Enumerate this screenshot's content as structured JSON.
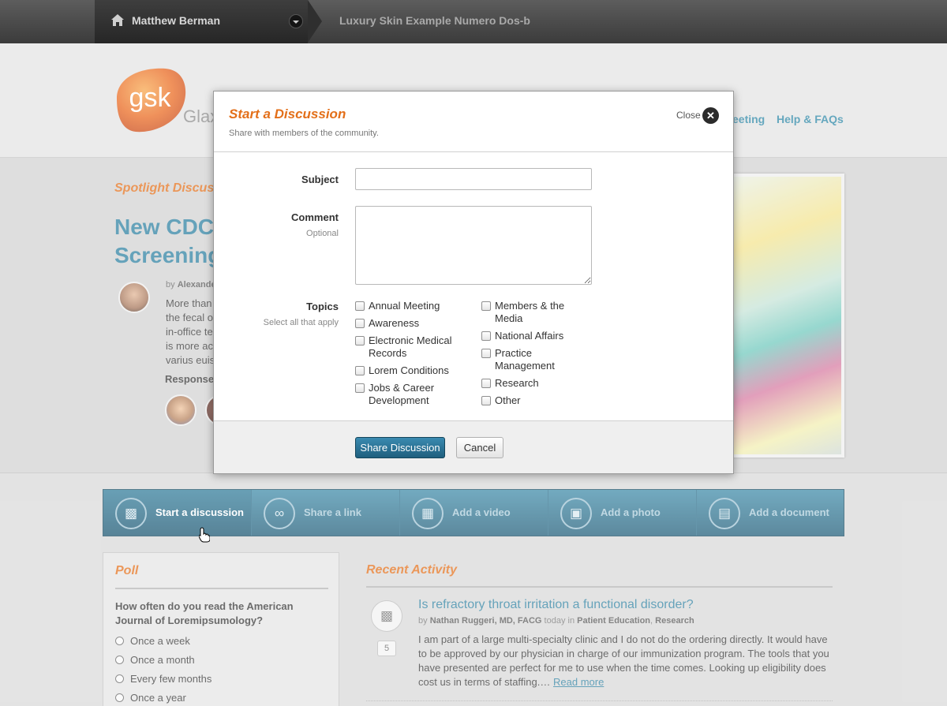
{
  "topbar": {
    "user_name": "Matthew Berman",
    "site_title": "Luxury Skin Example Numero Dos-b"
  },
  "header": {
    "logo_text": "gsk",
    "logo_wordmark": "Glax",
    "nav": {
      "meeting": "eeting",
      "help": "Help & FAQs"
    }
  },
  "spotlight": {
    "heading": "Spotlight Discuss",
    "title_line1": "New CDC",
    "title_line2": "Screening",
    "byline_prefix": "by",
    "byline_author": "Alexande",
    "excerpt": [
      "More than",
      "the fecal o",
      "in-office te",
      "is more ac",
      "varius euis"
    ],
    "responses_label": "Responses"
  },
  "modal": {
    "title": "Start a Discussion",
    "subtitle": "Share with members of the community.",
    "close_label": "Close",
    "subject_label": "Subject",
    "subject_value": "",
    "comment_label": "Comment",
    "comment_hint": "Optional",
    "comment_value": "",
    "topics_label": "Topics",
    "topics_hint": "Select all that apply",
    "topics_col1": [
      "Annual Meeting",
      "Awareness",
      "Electronic Medical Records",
      "Lorem Conditions",
      "Jobs & Career Development"
    ],
    "topics_col2": [
      "Members & the Media",
      "National Affairs",
      "Practice Management",
      "Research",
      "Other"
    ],
    "share_label": "Share Discussion",
    "cancel_label": "Cancel"
  },
  "actions": [
    {
      "label": "Start a discussion",
      "icon": "speech-bubble-icon",
      "active": true
    },
    {
      "label": "Share a link",
      "icon": "link-icon",
      "active": false
    },
    {
      "label": "Add a video",
      "icon": "film-icon",
      "active": false
    },
    {
      "label": "Add a photo",
      "icon": "photo-icon",
      "active": false
    },
    {
      "label": "Add a document",
      "icon": "document-icon",
      "active": false
    }
  ],
  "poll": {
    "title": "Poll",
    "question": "How often do you read the American Journal of Loremipsumology?",
    "options": [
      "Once a week",
      "Once a month",
      "Every few months",
      "Once a year"
    ]
  },
  "recent": {
    "title": "Recent Activity",
    "item": {
      "count": "5",
      "title": "Is refractory throat irritation a functional disorder?",
      "by": "by",
      "author": "Nathan Ruggeri, MD, FACG",
      "when": "today in",
      "category1": "Patient Education",
      "category2": "Research",
      "text": "I am part of a large multi-specialty clinic and I do not do the ordering directly. It would have to be approved by our physician in charge of our immunization program. The tools that you have presented are perfect for me to use when the time comes. Looking up eligibility does cost us in terms of staffing.…",
      "read_more": "Read more"
    }
  },
  "colors": {
    "accent_orange": "#e36f19",
    "link_blue": "#2a7fa0",
    "action_bar": "#1e5c78"
  }
}
